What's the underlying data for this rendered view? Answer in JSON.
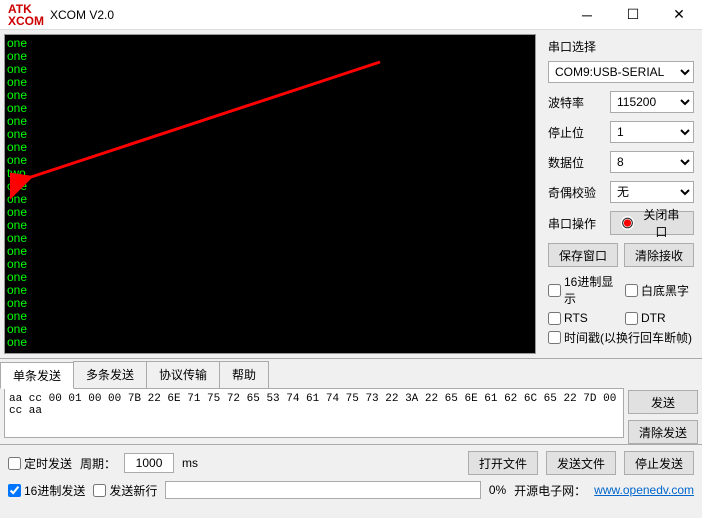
{
  "window": {
    "title": "XCOM V2.0",
    "logo_top": "ATK",
    "logo_bottom": "XCOM"
  },
  "terminal_lines": [
    "one",
    "one",
    "one",
    "one",
    "one",
    "one",
    "one",
    "one",
    "one",
    "one",
    "two",
    "one",
    "one",
    "one",
    "one",
    "one",
    "one",
    "one",
    "one",
    "one",
    "one",
    "one",
    "one",
    "one"
  ],
  "side": {
    "group_title": "串口选择",
    "port": "COM9:USB-SERIAL",
    "baud_label": "波特率",
    "baud": "115200",
    "stop_label": "停止位",
    "stop": "1",
    "data_label": "数据位",
    "data": "8",
    "parity_label": "奇偶校验",
    "parity": "无",
    "op_label": "串口操作",
    "op_btn": "关闭串口",
    "save_window": "保存窗口",
    "clear_recv": "清除接收",
    "hex_disp": "16进制显示",
    "white_bg": "白底黑字",
    "rts": "RTS",
    "dtr": "DTR",
    "timestamp": "时间戳(以换行回车断帧)"
  },
  "tabs": [
    "单条发送",
    "多条发送",
    "协议传输",
    "帮助"
  ],
  "send_text": "aa cc 00 01 00 00 7B 22 6E 71 75 72 65 53 74 61 74 75 73 22 3A 22 65 6E 61 62 6C 65 22 7D 00 cc aa",
  "send_btn": "发送",
  "clear_send": "清除发送",
  "bottom": {
    "timed_send": "定时发送",
    "period_label": "周期：",
    "period": "1000",
    "period_unit": "ms",
    "open_file": "打开文件",
    "send_file": "发送文件",
    "stop_send": "停止发送",
    "hex_send": "16进制发送",
    "send_newline": "发送新行",
    "progress": "0%",
    "link_text": "开源电子网：",
    "link_url": "www.openedv.com"
  }
}
